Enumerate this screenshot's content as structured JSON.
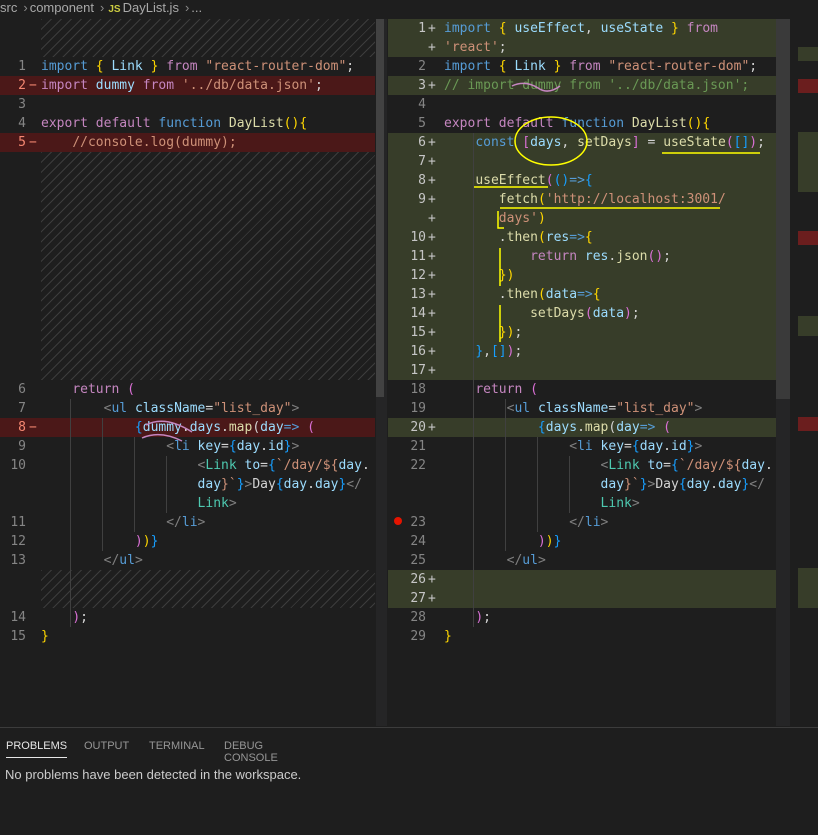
{
  "breadcrumb": {
    "folder1": "src",
    "folder2": "component",
    "file_badge": "JS",
    "file": "DayList.js",
    "more": "..."
  },
  "panel": {
    "tabs": [
      "PROBLEMS",
      "OUTPUT",
      "TERMINAL",
      "DEBUG CONSOLE"
    ],
    "active_tab": "PROBLEMS",
    "message": "No problems have been detected in the workspace."
  },
  "colors": {
    "deleted_bg": "#4b1818",
    "inserted_bg": "#373d29",
    "breakpoint": "#e51400",
    "annotation": "#ffff00"
  },
  "left": {
    "ln": [
      "1",
      "2",
      "3",
      "4",
      "5",
      "6",
      "7",
      "8",
      "9",
      "10",
      "11",
      "12",
      "13",
      "14",
      "15"
    ],
    "markers": {
      "deleted": "−"
    }
  },
  "right": {
    "ln": [
      "1",
      "2",
      "3",
      "4",
      "5",
      "6",
      "7",
      "8",
      "9",
      "10",
      "11",
      "12",
      "13",
      "14",
      "15",
      "16",
      "17",
      "18",
      "19",
      "20",
      "21",
      "22",
      "23",
      "24",
      "25",
      "26",
      "27",
      "28",
      "29"
    ],
    "markers": {
      "added": "+"
    }
  }
}
